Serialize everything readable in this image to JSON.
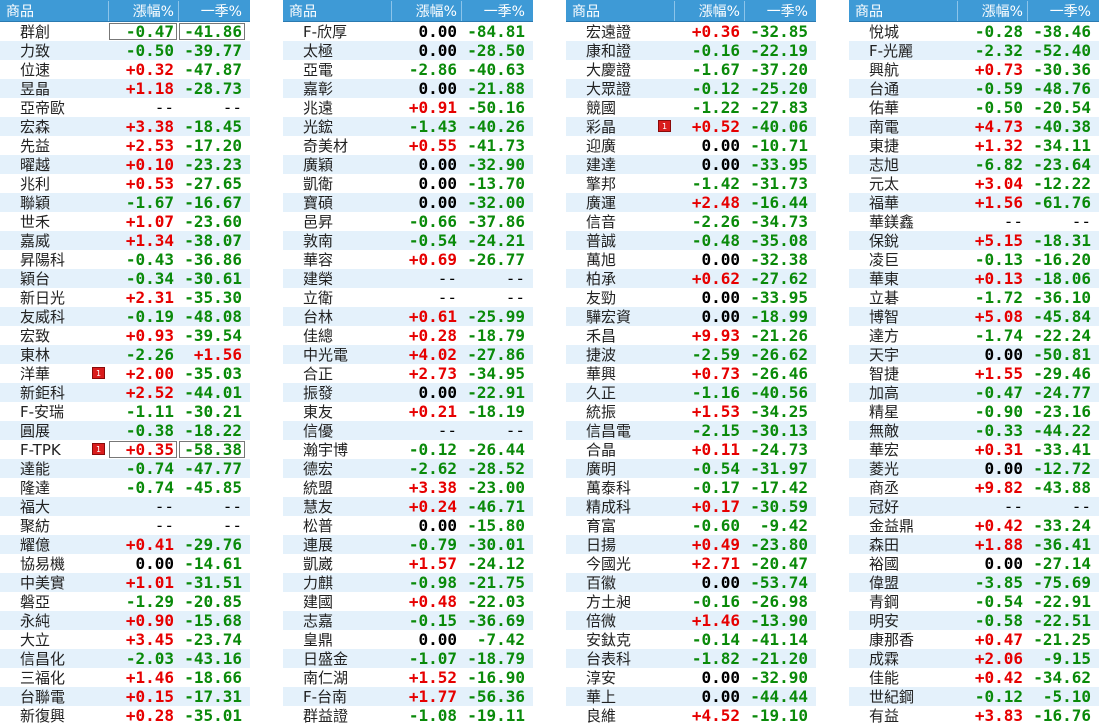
{
  "header": {
    "name": "商品",
    "change": "漲幅%",
    "quarter": "一季%"
  },
  "columns": [
    {
      "rows": [
        {
          "name": "群創",
          "chg": "-0.47",
          "q": "-41.86",
          "boxed": true
        },
        {
          "name": "力致",
          "chg": "-0.50",
          "q": "-39.77"
        },
        {
          "name": "位速",
          "chg": "+0.32",
          "q": "-47.87"
        },
        {
          "name": "昱晶",
          "chg": "+1.18",
          "q": "-28.73"
        },
        {
          "name": "亞帝歐",
          "chg": "--",
          "q": "--"
        },
        {
          "name": "宏森",
          "chg": "+3.38",
          "q": "-18.45"
        },
        {
          "name": "先益",
          "chg": "+2.53",
          "q": "-17.20"
        },
        {
          "name": "曜越",
          "chg": "+0.10",
          "q": "-23.23"
        },
        {
          "name": "兆利",
          "chg": "+0.53",
          "q": "-27.65"
        },
        {
          "name": "聯穎",
          "chg": "-1.67",
          "q": "-16.67"
        },
        {
          "name": "世禾",
          "chg": "+1.07",
          "q": "-23.60"
        },
        {
          "name": "嘉威",
          "chg": "+1.34",
          "q": "-38.07"
        },
        {
          "name": "昇陽科",
          "chg": "-0.43",
          "q": "-36.86"
        },
        {
          "name": "穎台",
          "chg": "-0.34",
          "q": "-30.61"
        },
        {
          "name": "新日光",
          "chg": "+2.31",
          "q": "-35.30"
        },
        {
          "name": "友威科",
          "chg": "-0.19",
          "q": "-48.08"
        },
        {
          "name": "宏致",
          "chg": "+0.93",
          "q": "-39.54"
        },
        {
          "name": "東林",
          "chg": "-2.26",
          "q": "+1.56"
        },
        {
          "name": "洋華",
          "chg": "+2.00",
          "q": "-35.03",
          "badge": "1"
        },
        {
          "name": "新鉅科",
          "chg": "+2.52",
          "q": "-44.01"
        },
        {
          "name": "F-安瑞",
          "chg": "-1.11",
          "q": "-30.21"
        },
        {
          "name": "圓展",
          "chg": "-0.38",
          "q": "-18.22"
        },
        {
          "name": "F-TPK",
          "chg": "+0.35",
          "q": "-58.38",
          "badge": "1",
          "boxed": true
        },
        {
          "name": "達能",
          "chg": "-0.74",
          "q": "-47.77"
        },
        {
          "name": "隆達",
          "chg": "-0.74",
          "q": "-45.85"
        },
        {
          "name": "福大",
          "chg": "--",
          "q": "--"
        },
        {
          "name": "聚紡",
          "chg": "--",
          "q": "--"
        },
        {
          "name": "耀億",
          "chg": "+0.41",
          "q": "-29.76"
        },
        {
          "name": "協易機",
          "chg": "0.00",
          "q": "-14.61"
        },
        {
          "name": "中美實",
          "chg": "+1.01",
          "q": "-31.51"
        },
        {
          "name": "磐亞",
          "chg": "-1.29",
          "q": "-20.85"
        },
        {
          "name": "永純",
          "chg": "+0.90",
          "q": "-15.68"
        },
        {
          "name": "大立",
          "chg": "+3.45",
          "q": "-23.74"
        },
        {
          "name": "信昌化",
          "chg": "-2.03",
          "q": "-43.16"
        },
        {
          "name": "三福化",
          "chg": "+1.46",
          "q": "-18.66"
        },
        {
          "name": "台聯電",
          "chg": "+0.15",
          "q": "-17.31"
        },
        {
          "name": "新復興",
          "chg": "+0.28",
          "q": "-35.01"
        }
      ]
    },
    {
      "rows": [
        {
          "name": "F-欣厚",
          "chg": "0.00",
          "q": "-84.81"
        },
        {
          "name": "太極",
          "chg": "0.00",
          "q": "-28.50"
        },
        {
          "name": "亞電",
          "chg": "-2.86",
          "q": "-40.63"
        },
        {
          "name": "嘉彰",
          "chg": "0.00",
          "q": "-21.88"
        },
        {
          "name": "兆遠",
          "chg": "+0.91",
          "q": "-50.16"
        },
        {
          "name": "光鋐",
          "chg": "-1.43",
          "q": "-40.26"
        },
        {
          "name": "奇美材",
          "chg": "+0.55",
          "q": "-41.73"
        },
        {
          "name": "廣穎",
          "chg": "0.00",
          "q": "-32.90"
        },
        {
          "name": "凱衛",
          "chg": "0.00",
          "q": "-13.70"
        },
        {
          "name": "寶碩",
          "chg": "0.00",
          "q": "-32.00"
        },
        {
          "name": "邑昇",
          "chg": "-0.66",
          "q": "-37.86"
        },
        {
          "name": "敦南",
          "chg": "-0.54",
          "q": "-24.21"
        },
        {
          "name": "華容",
          "chg": "+0.69",
          "q": "-26.77"
        },
        {
          "name": "建榮",
          "chg": "--",
          "q": "--"
        },
        {
          "name": "立衛",
          "chg": "--",
          "q": "--"
        },
        {
          "name": "台林",
          "chg": "+0.61",
          "q": "-25.99"
        },
        {
          "name": "佳總",
          "chg": "+0.28",
          "q": "-18.79"
        },
        {
          "name": "中光電",
          "chg": "+4.02",
          "q": "-27.86"
        },
        {
          "name": "合正",
          "chg": "+2.73",
          "q": "-34.95"
        },
        {
          "name": "振發",
          "chg": "0.00",
          "q": "-22.91"
        },
        {
          "name": "東友",
          "chg": "+0.21",
          "q": "-18.19"
        },
        {
          "name": "信優",
          "chg": "--",
          "q": "--"
        },
        {
          "name": "瀚宇博",
          "chg": "-0.12",
          "q": "-26.44"
        },
        {
          "name": "德宏",
          "chg": "-2.62",
          "q": "-28.52"
        },
        {
          "name": "統盟",
          "chg": "+3.38",
          "q": "-23.00"
        },
        {
          "name": "慧友",
          "chg": "+0.24",
          "q": "-46.71"
        },
        {
          "name": "松普",
          "chg": "0.00",
          "q": "-15.80"
        },
        {
          "name": "連展",
          "chg": "-0.79",
          "q": "-30.01"
        },
        {
          "name": "凱崴",
          "chg": "+1.57",
          "q": "-24.12"
        },
        {
          "name": "力麒",
          "chg": "-0.98",
          "q": "-21.75"
        },
        {
          "name": "建國",
          "chg": "+0.48",
          "q": "-22.03"
        },
        {
          "name": "志嘉",
          "chg": "-0.15",
          "q": "-36.69"
        },
        {
          "name": "皇鼎",
          "chg": "0.00",
          "q": "-7.42"
        },
        {
          "name": "日盛金",
          "chg": "-1.07",
          "q": "-18.79"
        },
        {
          "name": "南仁湖",
          "chg": "+1.52",
          "q": "-16.90"
        },
        {
          "name": "F-台南",
          "chg": "+1.77",
          "q": "-56.36"
        },
        {
          "name": "群益證",
          "chg": "-1.08",
          "q": "-19.11"
        }
      ]
    },
    {
      "rows": [
        {
          "name": "宏遠證",
          "chg": "+0.36",
          "q": "-32.85"
        },
        {
          "name": "康和證",
          "chg": "-0.16",
          "q": "-22.19"
        },
        {
          "name": "大慶證",
          "chg": "-1.67",
          "q": "-37.20"
        },
        {
          "name": "大眾證",
          "chg": "-0.12",
          "q": "-25.20"
        },
        {
          "name": "競國",
          "chg": "-1.22",
          "q": "-27.83"
        },
        {
          "name": "彩晶",
          "chg": "+0.52",
          "q": "-40.06",
          "badge": "1"
        },
        {
          "name": "迎廣",
          "chg": "0.00",
          "q": "-10.71"
        },
        {
          "name": "建達",
          "chg": "0.00",
          "q": "-33.95"
        },
        {
          "name": "擎邦",
          "chg": "-1.42",
          "q": "-31.73"
        },
        {
          "name": "廣運",
          "chg": "+2.48",
          "q": "-16.44"
        },
        {
          "name": "信音",
          "chg": "-2.26",
          "q": "-34.73"
        },
        {
          "name": "普誠",
          "chg": "-0.48",
          "q": "-35.08"
        },
        {
          "name": "萬旭",
          "chg": "0.00",
          "q": "-32.38"
        },
        {
          "name": "柏承",
          "chg": "+0.62",
          "q": "-27.62"
        },
        {
          "name": "友勁",
          "chg": "0.00",
          "q": "-33.95"
        },
        {
          "name": "驊宏資",
          "chg": "0.00",
          "q": "-18.99"
        },
        {
          "name": "禾昌",
          "chg": "+9.93",
          "q": "-21.26"
        },
        {
          "name": "捷波",
          "chg": "-2.59",
          "q": "-26.62"
        },
        {
          "name": "華興",
          "chg": "+0.73",
          "q": "-26.46"
        },
        {
          "name": "久正",
          "chg": "-1.16",
          "q": "-40.56"
        },
        {
          "name": "統振",
          "chg": "+1.53",
          "q": "-34.25"
        },
        {
          "name": "信昌電",
          "chg": "-2.15",
          "q": "-30.13"
        },
        {
          "name": "合晶",
          "chg": "+0.11",
          "q": "-24.73"
        },
        {
          "name": "廣明",
          "chg": "-0.54",
          "q": "-31.97"
        },
        {
          "name": "萬泰科",
          "chg": "-0.17",
          "q": "-17.42"
        },
        {
          "name": "精成科",
          "chg": "+0.17",
          "q": "-30.59"
        },
        {
          "name": "育富",
          "chg": "-0.60",
          "q": "-9.42"
        },
        {
          "name": "日揚",
          "chg": "+0.49",
          "q": "-23.80"
        },
        {
          "name": "今國光",
          "chg": "+2.71",
          "q": "-20.47"
        },
        {
          "name": "百徽",
          "chg": "0.00",
          "q": "-53.74"
        },
        {
          "name": "方土昶",
          "chg": "-0.16",
          "q": "-26.98"
        },
        {
          "name": "倍微",
          "chg": "+1.46",
          "q": "-13.90"
        },
        {
          "name": "安鈦克",
          "chg": "-0.14",
          "q": "-41.14"
        },
        {
          "name": "台表科",
          "chg": "-1.82",
          "q": "-21.20"
        },
        {
          "name": "淳安",
          "chg": "0.00",
          "q": "-32.90"
        },
        {
          "name": "華上",
          "chg": "0.00",
          "q": "-44.44"
        },
        {
          "name": "良維",
          "chg": "+4.52",
          "q": "-19.10"
        }
      ]
    },
    {
      "rows": [
        {
          "name": "悅城",
          "chg": "-0.28",
          "q": "-38.46"
        },
        {
          "name": "F-光麗",
          "chg": "-2.32",
          "q": "-52.40"
        },
        {
          "name": "興航",
          "chg": "+0.73",
          "q": "-30.36"
        },
        {
          "name": "台通",
          "chg": "-0.59",
          "q": "-48.76"
        },
        {
          "name": "佑華",
          "chg": "-0.50",
          "q": "-20.54"
        },
        {
          "name": "南電",
          "chg": "+4.73",
          "q": "-40.38"
        },
        {
          "name": "東捷",
          "chg": "+1.32",
          "q": "-34.11"
        },
        {
          "name": "志旭",
          "chg": "-6.82",
          "q": "-23.64"
        },
        {
          "name": "元太",
          "chg": "+3.04",
          "q": "-12.22"
        },
        {
          "name": "福華",
          "chg": "+1.56",
          "q": "-61.76"
        },
        {
          "name": "華鎂鑫",
          "chg": "--",
          "q": "--"
        },
        {
          "name": "保銳",
          "chg": "+5.15",
          "q": "-18.31"
        },
        {
          "name": "凌巨",
          "chg": "-0.13",
          "q": "-16.20"
        },
        {
          "name": "華東",
          "chg": "+0.13",
          "q": "-18.06"
        },
        {
          "name": "立碁",
          "chg": "-1.72",
          "q": "-36.10"
        },
        {
          "name": "博智",
          "chg": "+5.08",
          "q": "-45.84"
        },
        {
          "name": "達方",
          "chg": "-1.74",
          "q": "-22.24"
        },
        {
          "name": "天宇",
          "chg": "0.00",
          "q": "-50.81"
        },
        {
          "name": "智捷",
          "chg": "+1.55",
          "q": "-29.46"
        },
        {
          "name": "加高",
          "chg": "-0.47",
          "q": "-24.77"
        },
        {
          "name": "精星",
          "chg": "-0.90",
          "q": "-23.16"
        },
        {
          "name": "無敵",
          "chg": "-0.33",
          "q": "-44.22"
        },
        {
          "name": "華宏",
          "chg": "+0.31",
          "q": "-33.41"
        },
        {
          "name": "菱光",
          "chg": "0.00",
          "q": "-12.72"
        },
        {
          "name": "商丞",
          "chg": "+9.82",
          "q": "-43.88"
        },
        {
          "name": "冠好",
          "chg": "--",
          "q": "--"
        },
        {
          "name": "金益鼎",
          "chg": "+0.42",
          "q": "-33.24"
        },
        {
          "name": "森田",
          "chg": "+1.88",
          "q": "-36.41"
        },
        {
          "name": "裕國",
          "chg": "0.00",
          "q": "-27.14"
        },
        {
          "name": "偉盟",
          "chg": "-3.85",
          "q": "-75.69"
        },
        {
          "name": "青鋼",
          "chg": "-0.54",
          "q": "-22.91"
        },
        {
          "name": "明安",
          "chg": "-0.58",
          "q": "-22.51"
        },
        {
          "name": "康那香",
          "chg": "+0.47",
          "q": "-21.25"
        },
        {
          "name": "成霖",
          "chg": "+2.06",
          "q": "-9.15"
        },
        {
          "name": "佳能",
          "chg": "+0.42",
          "q": "-34.62"
        },
        {
          "name": "世紀鋼",
          "chg": "-0.12",
          "q": "-5.10"
        },
        {
          "name": "有益",
          "chg": "+3.83",
          "q": "-16.76"
        }
      ]
    }
  ]
}
